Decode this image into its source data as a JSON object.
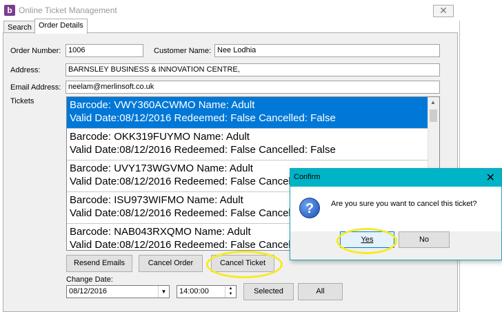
{
  "window": {
    "app_icon": "b",
    "title": "Online Ticket Management",
    "close_glyph": "✕"
  },
  "tabs": [
    "Search",
    "Order Details"
  ],
  "form": {
    "order_number_label": "Order Number:",
    "order_number_value": "1006",
    "customer_name_label": "Customer Name:",
    "customer_name_value": "Nee Lodhia",
    "address_label": "Address:",
    "address_value": "BARNSLEY BUSINESS & INNOVATION CENTRE,",
    "email_label": "Email Address:",
    "email_value": "neelam@merlinsoft.co.uk",
    "tickets_label": "Tickets"
  },
  "tickets": [
    {
      "line1": "Barcode: VWY360ACWMO Name: Adult",
      "line2": "Valid Date:08/12/2016 Redeemed:  False  Cancelled:  False",
      "selected": true
    },
    {
      "line1": "Barcode: OKK319FUYMO Name: Adult",
      "line2": "Valid Date:08/12/2016 Redeemed:  False  Cancelled:  False",
      "selected": false
    },
    {
      "line1": "Barcode: UVY173WGVMO Name: Adult",
      "line2": "Valid Date:08/12/2016 Redeemed:  False  Cancelled:  False",
      "selected": false
    },
    {
      "line1": "Barcode: ISU973WIFMO Name: Adult",
      "line2": "Valid Date:08/12/2016 Redeemed:  False  Cancelled:  False",
      "selected": false
    },
    {
      "line1": "Barcode: NAB043RXQMO Name: Adult",
      "line2": "Valid Date:08/12/2016 Redeemed:  False  Cancelled:  False",
      "selected": false
    }
  ],
  "buttons": {
    "resend_emails": "Resend  Emails",
    "cancel_order": "Cancel Order",
    "cancel_ticket": "Cancel Ticket",
    "selected": "Selected",
    "all": "All"
  },
  "change_date": {
    "label": "Change Date:",
    "date_value": "08/12/2016",
    "time_value": "14:00:00"
  },
  "dialog": {
    "title": "Confirm",
    "close_glyph": "✕",
    "icon_glyph": "?",
    "message": "Are you sure you want to cancel this ticket?",
    "yes_label": "Yes",
    "no_label": "No"
  },
  "colors": {
    "selection": "#0078d7",
    "dialog_title": "#00b4c7",
    "highlight_ring": "#f7ea21"
  }
}
